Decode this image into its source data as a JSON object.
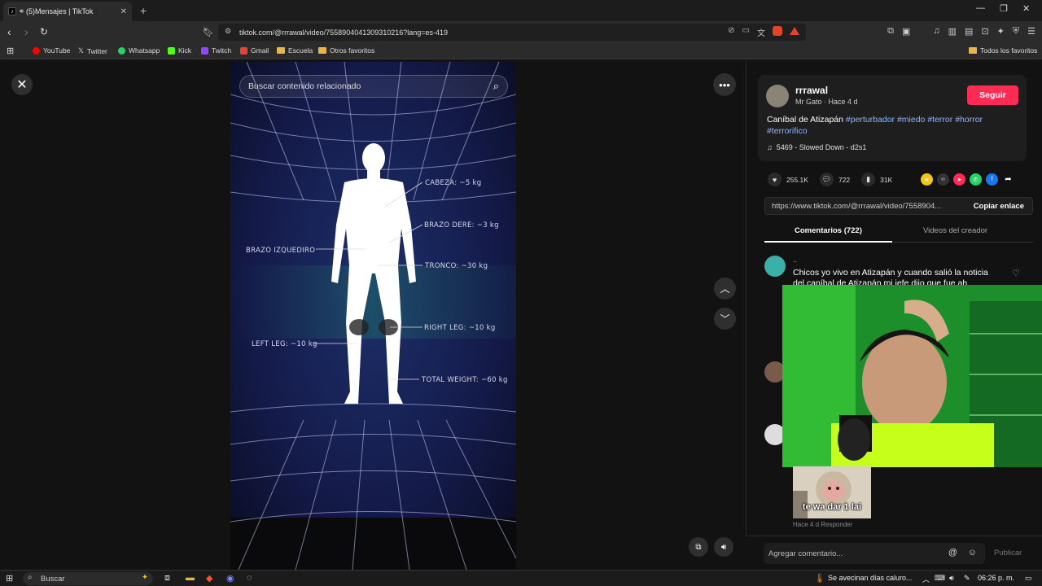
{
  "browser": {
    "tab_title": "(5)Mensajes | TikTok",
    "url": "tiktok.com/@rrrawal/video/7558904041309310216?lang=es-419",
    "bookmarks": [
      "YouTube",
      "Twitter",
      "Whatsapp",
      "Kick",
      "Twitch",
      "Gmail",
      "Escuela",
      "Otros favoritos"
    ],
    "all_bookmarks": "Todos los favoritos"
  },
  "video": {
    "search_placeholder": "Buscar contenido relacionado",
    "labels": {
      "cabeza": "CABEZA: ~5 kg",
      "brazo_der": "BRAZO DERE: ~3 kg",
      "brazo_izq": "BRAZO IZQUEDIRO",
      "tronco": "TRONCO: ~30 kg",
      "right_leg": "RIGHT LEG: ~10 kg",
      "left_leg": "LEFT LEG: ~10 kg",
      "total": "TOTAL WEIGHT: ~60 kg"
    }
  },
  "post": {
    "username": "rrrawal",
    "subtitle": "Mr Gato · Hace 4 d",
    "follow_label": "Seguir",
    "desc_plain": "Caníbal de Atizapán ",
    "tags": [
      "#perturbador",
      "#miedo",
      "#terror",
      "#horror",
      "#terrorifico"
    ],
    "music": "5469 - Slowed Down - d2s1",
    "likes": "255.1K",
    "comments": "722",
    "saves": "31K",
    "link": "https://www.tiktok.com/@rrrawal/video/7558904...",
    "copy_label": "Copiar enlace"
  },
  "tabs": {
    "comments": "Comentarios (722)",
    "creator_videos": "Videos del creador"
  },
  "comment1": {
    "name": "..",
    "text": "Chicos yo vivo en Atizapán y cuando salió la noticia del caníbal de Atizapán mi jefe dijo que fue ah"
  },
  "meme_caption": "te wa dar 1 lai",
  "reply_meta": "Hace 4 d   Responder",
  "composer": {
    "placeholder": "Agregar comentario...",
    "publish": "Publicar"
  },
  "taskbar": {
    "search": "Buscar",
    "weather": "Se avecinan días caluro...",
    "time": "06:26 p. m."
  },
  "colors": {
    "follow": "#fe2c55",
    "hashtag": "#8fb7ff"
  }
}
